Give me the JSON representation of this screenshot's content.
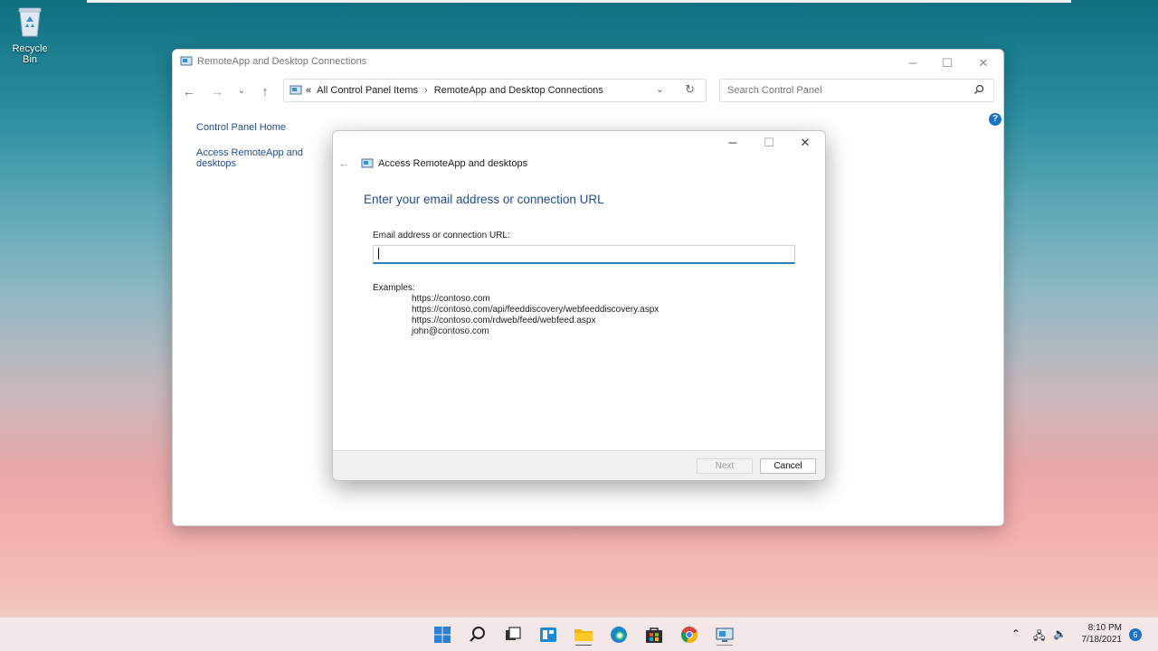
{
  "desktop": {
    "recycle_bin_label": "Recycle Bin"
  },
  "main_window": {
    "title": "RemoteApp and Desktop Connections",
    "breadcrumb": {
      "prefix": "«",
      "items": [
        "All Control Panel Items",
        "RemoteApp and Desktop Connections"
      ]
    },
    "search_placeholder": "Search Control Panel",
    "sidebar": {
      "items": [
        {
          "label": "Control Panel Home"
        },
        {
          "label": "Access RemoteApp and desktops"
        }
      ]
    },
    "help_label": "?"
  },
  "dialog": {
    "header_title": "Access RemoteApp and desktops",
    "title": "Enter your email address or connection URL",
    "field_label": "Email address or connection URL:",
    "field_value": "",
    "examples_label": "Examples:",
    "examples": [
      "https://contoso.com",
      "https://contoso.com/api/feeddiscovery/webfeeddiscovery.aspx",
      "https://contoso.com/rdweb/feed/webfeed.aspx",
      "john@contoso.com"
    ],
    "next_label": "Next",
    "cancel_label": "Cancel"
  },
  "taskbar": {
    "time": "8:10 PM",
    "date": "7/18/2021",
    "notification_count": "6"
  },
  "colors": {
    "accent": "#1a73c8",
    "link": "#1f4e8c",
    "input_focus": "#2a7fb8"
  }
}
